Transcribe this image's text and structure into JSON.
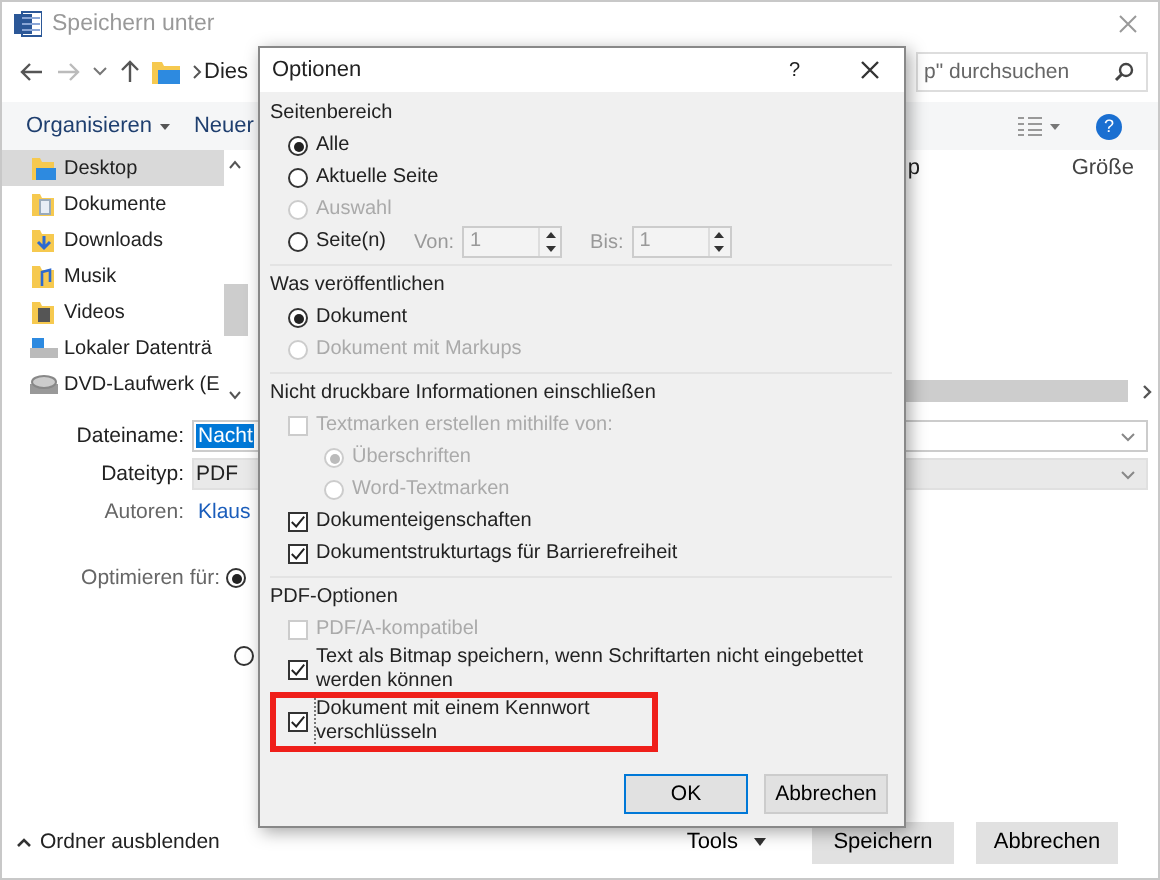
{
  "window": {
    "title": "Speichern unter"
  },
  "nav": {
    "path": "Dies"
  },
  "search": {
    "placeholder": "p\" durchsuchen"
  },
  "toolbar": {
    "organize": "Organisieren",
    "new_folder": "Neuer",
    "help": "?"
  },
  "sidebar": {
    "items": [
      {
        "label": "Desktop",
        "kind": "desktop",
        "selected": true
      },
      {
        "label": "Dokumente",
        "kind": "documents",
        "selected": false
      },
      {
        "label": "Downloads",
        "kind": "downloads",
        "selected": false
      },
      {
        "label": "Musik",
        "kind": "music",
        "selected": false
      },
      {
        "label": "Videos",
        "kind": "videos",
        "selected": false
      },
      {
        "label": "Lokaler Datenträ",
        "kind": "drive",
        "selected": false
      },
      {
        "label": "DVD-Laufwerk (E",
        "kind": "dvd",
        "selected": false
      }
    ]
  },
  "file_list": {
    "columns": [
      "p",
      "Größe"
    ]
  },
  "form": {
    "filename_label": "Dateiname:",
    "filename": "Nacht",
    "filetype_label": "Dateityp:",
    "filetype": "PDF",
    "authors_label": "Autoren:",
    "authors": "Klaus",
    "optimize_label": "Optimieren für:",
    "optimize_options": [
      {
        "selected": true
      },
      {
        "selected": false
      }
    ]
  },
  "footer": {
    "hide_folders": "Ordner ausblenden",
    "buttons": [
      {
        "label": "Tools",
        "kind": "menu"
      },
      {
        "label": "Speichern",
        "kind": "push"
      },
      {
        "label": "Abbrechen",
        "kind": "push"
      }
    ]
  },
  "dialog": {
    "title": "Optionen",
    "help": "?",
    "sections": [
      {
        "title": "Seitenbereich",
        "items": [
          {
            "kind": "radio",
            "label": "Alle",
            "selected": true,
            "disabled": false
          },
          {
            "kind": "radio",
            "label": "Aktuelle Seite",
            "selected": false,
            "disabled": false
          },
          {
            "kind": "radio",
            "label": "Auswahl",
            "selected": false,
            "disabled": true
          },
          {
            "kind": "range",
            "label": "Seite(n)",
            "selected": false,
            "disabled": false,
            "from_label": "Von:",
            "from": "1",
            "to_label": "Bis:",
            "to": "1"
          }
        ]
      },
      {
        "title": "Was veröffentlichen",
        "items": [
          {
            "kind": "radio",
            "label": "Dokument",
            "selected": true,
            "disabled": false
          },
          {
            "kind": "radio",
            "label": "Dokument mit Markups",
            "selected": false,
            "disabled": true
          }
        ]
      },
      {
        "title": "Nicht druckbare Informationen einschließen",
        "items": [
          {
            "kind": "checkbox",
            "label": "Textmarken erstellen mithilfe von:",
            "checked": false,
            "disabled": true,
            "children": [
              {
                "kind": "radio",
                "label": "Überschriften",
                "selected": true,
                "disabled": true
              },
              {
                "kind": "radio",
                "label": "Word-Textmarken",
                "selected": false,
                "disabled": true
              }
            ]
          },
          {
            "kind": "checkbox",
            "label": "Dokumenteigenschaften",
            "checked": true,
            "disabled": false
          },
          {
            "kind": "checkbox",
            "label": "Dokumentstrukturtags für Barrierefreiheit",
            "checked": true,
            "disabled": false
          }
        ]
      },
      {
        "title": "PDF-Optionen",
        "items": [
          {
            "kind": "checkbox",
            "label": "PDF/A-kompatibel",
            "checked": false,
            "disabled": true,
            "highlighted": false
          },
          {
            "kind": "checkbox",
            "label": "Text als Bitmap speichern, wenn Schriftarten nicht eingebettet werden können",
            "checked": true,
            "disabled": false,
            "highlighted": false
          },
          {
            "kind": "checkbox",
            "label": "Dokument mit einem Kennwort verschlüsseln",
            "checked": true,
            "disabled": false,
            "highlighted": true
          }
        ]
      }
    ],
    "buttons": [
      {
        "label": "OK",
        "default": true
      },
      {
        "label": "Abbrechen",
        "default": false
      }
    ]
  }
}
